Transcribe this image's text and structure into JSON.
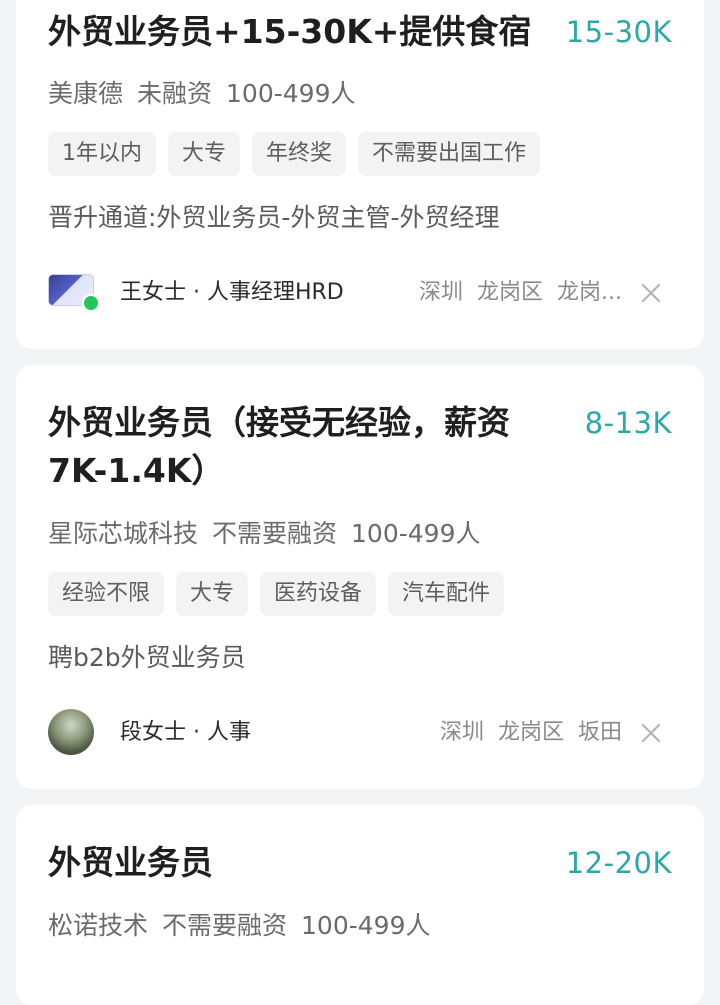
{
  "jobs": [
    {
      "title": "外贸业务员+15-30K+提供食宿",
      "salary": "15-30K",
      "company": "美康德",
      "funding": "未融资",
      "size": "100-499人",
      "tags": [
        "1年以内",
        "大专",
        "年终奖",
        "不需要出国工作"
      ],
      "description": "晋升通道:外贸业务员-外贸主管-外贸经理",
      "recruiter": "王女士 · 人事经理HRD",
      "location": [
        "深圳",
        "龙岗区",
        "龙岗..."
      ]
    },
    {
      "title": "外贸业务员（接受无经验，薪资7K-1.4K）",
      "salary": "8-13K",
      "company": "星际芯城科技",
      "funding": "不需要融资",
      "size": "100-499人",
      "tags": [
        "经验不限",
        "大专",
        "医药设备",
        "汽车配件"
      ],
      "description": "聘b2b外贸业务员",
      "recruiter": "段女士 · 人事",
      "location": [
        "深圳",
        "龙岗区",
        "坂田"
      ]
    },
    {
      "title": "外贸业务员",
      "salary": "12-20K",
      "company": "松诺技术",
      "funding": "不需要融资",
      "size": "100-499人"
    }
  ],
  "icons": {
    "close": "close-icon",
    "online": "online-status-dot"
  },
  "colors": {
    "salary": "#2aa9a6",
    "online": "#22c55e",
    "background": "#f3f4f6"
  }
}
